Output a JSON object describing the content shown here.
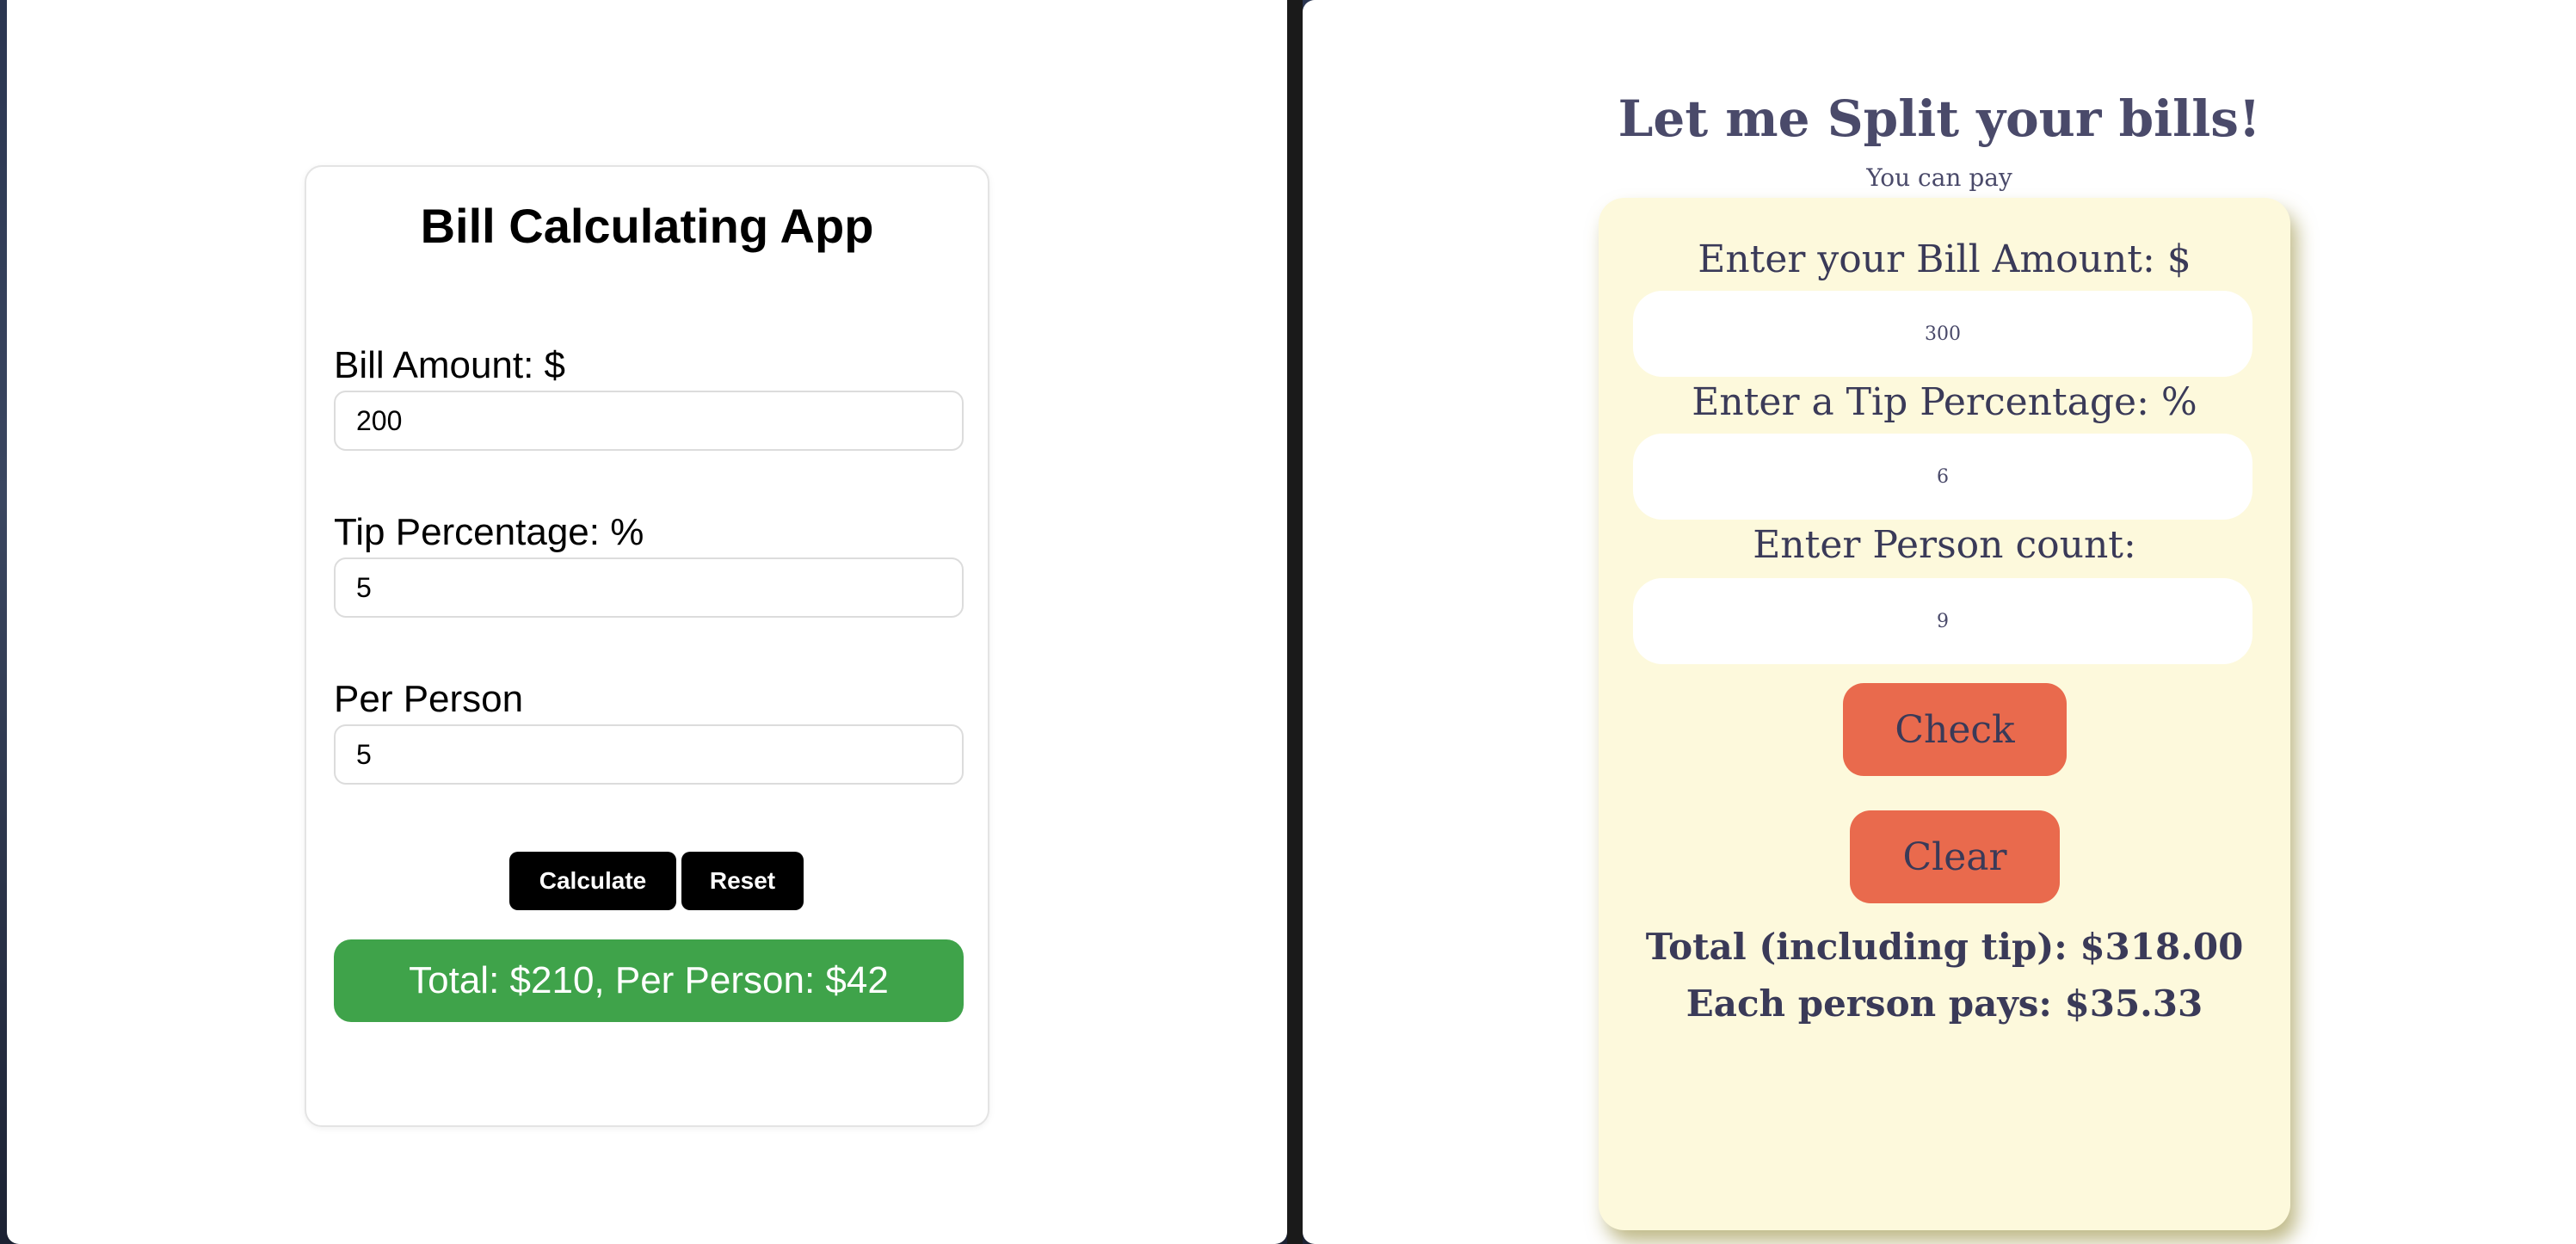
{
  "left_app": {
    "title": "Bill Calculating App",
    "fields": [
      {
        "label": "Bill Amount: $",
        "value": "200"
      },
      {
        "label": "Tip Percentage: %",
        "value": "5"
      },
      {
        "label": "Per Person",
        "value": "5"
      }
    ],
    "calculate_label": "Calculate",
    "reset_label": "Reset",
    "result": "Total: $210, Per Person: $42",
    "colors": {
      "result_bg": "#3fa34a",
      "button_bg": "#000000"
    }
  },
  "right_app": {
    "title": "Let me Split your bills!",
    "subtitle": "You can pay",
    "fields": [
      {
        "label": "Enter your Bill Amount: $",
        "value": "300"
      },
      {
        "label": "Enter a Tip Percentage: %",
        "value": "6"
      },
      {
        "label": "Enter Person count:",
        "value": "9"
      }
    ],
    "check_label": "Check",
    "clear_label": "Clear",
    "total_line": "Total (including tip): $318.00",
    "each_line": "Each person pays: $35.33",
    "colors": {
      "card_bg": "#fdf9dc",
      "button_bg": "#e96a4d"
    }
  }
}
